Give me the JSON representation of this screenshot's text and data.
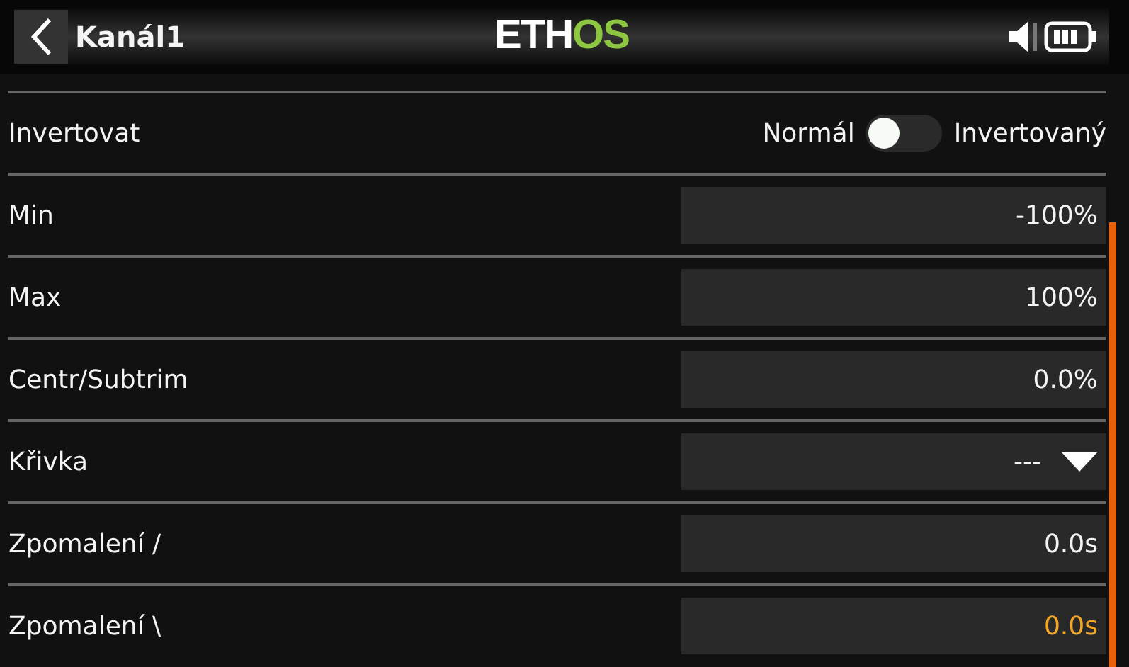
{
  "header": {
    "title": "Kanál1",
    "logo": [
      {
        "text": "ETH",
        "color": "#ffffff"
      },
      {
        "text": "OS",
        "color": "#8dc63f"
      }
    ]
  },
  "rows": [
    {
      "kind": "toggle",
      "label": "Invertovat",
      "off_label": "Normál",
      "on_label": "Invertovaný",
      "on": false,
      "selected": false
    },
    {
      "kind": "value",
      "label": "Min",
      "value": "-100%",
      "selected": false
    },
    {
      "kind": "value",
      "label": "Max",
      "value": "100%",
      "selected": false
    },
    {
      "kind": "value",
      "label": "Centr/Subtrim",
      "value": "0.0%",
      "selected": false
    },
    {
      "kind": "choice",
      "label": "Křivka",
      "value": "---",
      "selected": false
    },
    {
      "kind": "value",
      "label": "Zpomalení /",
      "value": "0.0s",
      "selected": false
    },
    {
      "kind": "value",
      "label": "Zpomalení \\",
      "value": "0.0s",
      "selected": true
    }
  ]
}
